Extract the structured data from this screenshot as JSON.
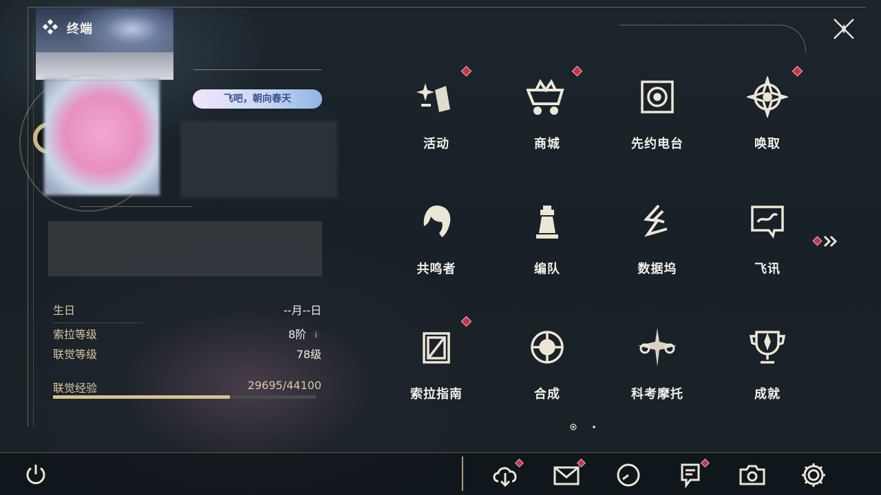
{
  "header": {
    "title": "终端"
  },
  "profile": {
    "badge_text": "飞吧，朝向春天",
    "stats": [
      {
        "label": "生日",
        "value": "--月--日"
      },
      {
        "label": "索拉等级",
        "value": "8阶"
      },
      {
        "label": "联觉等级",
        "value": "78级"
      }
    ],
    "exp": {
      "label": "联觉经验",
      "value": "29695/44100",
      "current": 29695,
      "max": 44100
    }
  },
  "menu": {
    "items": [
      {
        "label": "活动",
        "icon": "event-icon",
        "notify": true
      },
      {
        "label": "商城",
        "icon": "shop-icon",
        "notify": true
      },
      {
        "label": "先约电台",
        "icon": "radio-icon",
        "notify": false
      },
      {
        "label": "唤取",
        "icon": "convene-icon",
        "notify": true
      },
      {
        "label": "共鸣者",
        "icon": "resonator-icon",
        "notify": false
      },
      {
        "label": "编队",
        "icon": "team-icon",
        "notify": false
      },
      {
        "label": "数据坞",
        "icon": "data-bank-icon",
        "notify": false
      },
      {
        "label": "飞讯",
        "icon": "messages-icon",
        "notify": false
      },
      {
        "label": "索拉指南",
        "icon": "guide-icon",
        "notify": true
      },
      {
        "label": "合成",
        "icon": "synthesis-icon",
        "notify": false
      },
      {
        "label": "科考摩托",
        "icon": "motorcycle-icon",
        "notify": false
      },
      {
        "label": "成就",
        "icon": "achievement-icon",
        "notify": false
      }
    ],
    "page": {
      "current": 1,
      "total": 2
    }
  },
  "bottom_bar": {
    "icons": [
      {
        "name": "download-icon",
        "notify": true
      },
      {
        "name": "mail-icon",
        "notify": true
      },
      {
        "name": "clock-icon",
        "notify": false
      },
      {
        "name": "notice-icon",
        "notify": true
      },
      {
        "name": "camera-icon",
        "notify": false
      },
      {
        "name": "settings-icon",
        "notify": false
      }
    ]
  },
  "colors": {
    "accent_gold": "#d6c48d",
    "notify_red": "#c8334a",
    "text_light": "#f2f0ea",
    "label_gold": "#d8c9a0"
  }
}
